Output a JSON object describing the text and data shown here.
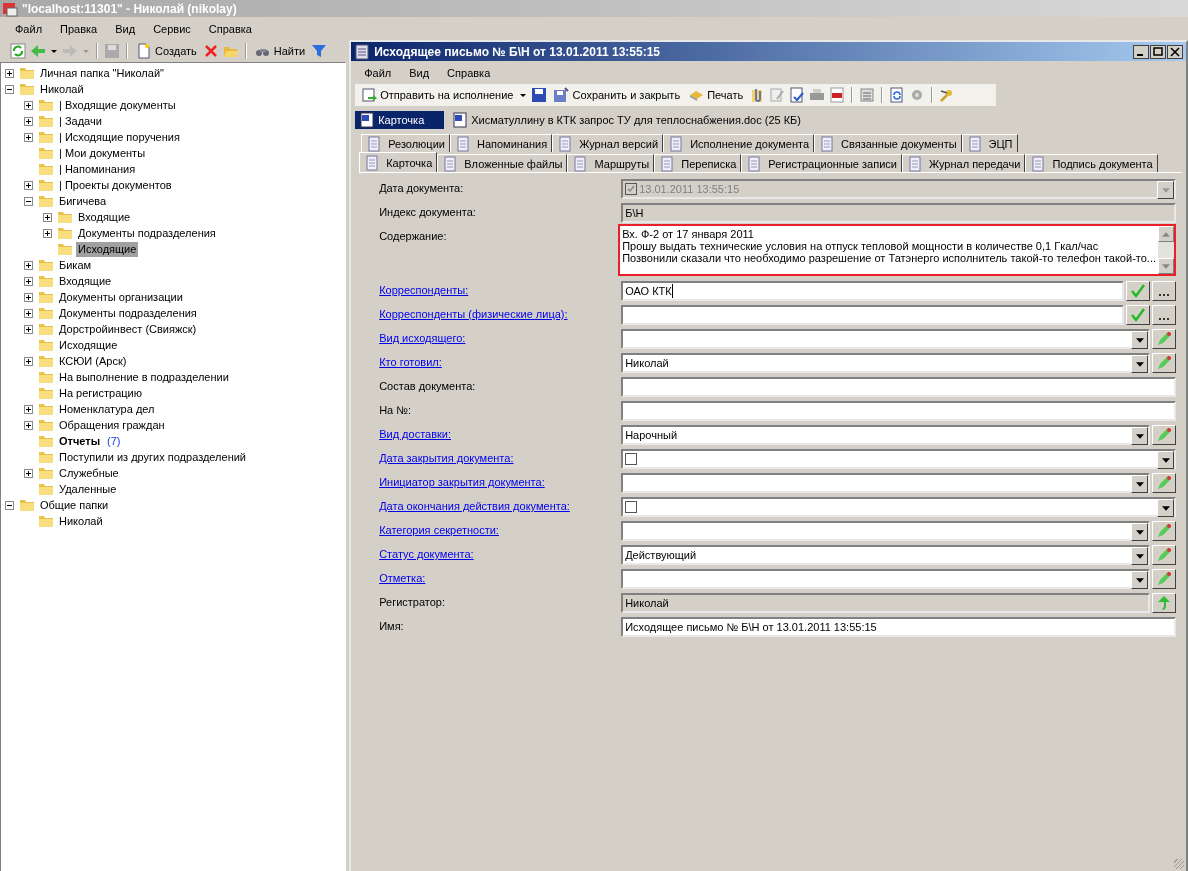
{
  "app": {
    "title": "\"localhost:11301\" - Николай (nikolay)",
    "menu": [
      "Файл",
      "Правка",
      "Вид",
      "Сервис",
      "Справка"
    ],
    "toolbar": [
      "Создать",
      "Найти"
    ]
  },
  "tree": [
    {
      "label": "Личная папка \"Николай\"",
      "expanded": false
    },
    {
      "label": "Николай",
      "expanded": true,
      "children": [
        {
          "label": "| Входящие документы",
          "expanded": false
        },
        {
          "label": "| Задачи",
          "expanded": false
        },
        {
          "label": "| Исходящие поручения",
          "expanded": false
        },
        {
          "label": "| Мои документы"
        },
        {
          "label": "| Напоминания"
        },
        {
          "label": "| Проекты документов",
          "expanded": false
        },
        {
          "label": "Бигичева",
          "expanded": true,
          "children": [
            {
              "label": "Входящие",
              "expanded": false
            },
            {
              "label": "Документы подразделения",
              "expanded": false
            },
            {
              "label": "Исходящие",
              "selected": true
            }
          ]
        },
        {
          "label": "Бикам",
          "expanded": false
        },
        {
          "label": "Входящие",
          "expanded": false
        },
        {
          "label": "Документы организации",
          "expanded": false
        },
        {
          "label": "Документы подразделения",
          "expanded": false
        },
        {
          "label": "Дорстройинвест (Свияжск)",
          "expanded": false
        },
        {
          "label": "Исходящие"
        },
        {
          "label": "КСЮИ (Арск)",
          "expanded": false
        },
        {
          "label": "На выполнение в подразделении"
        },
        {
          "label": "На регистрацию"
        },
        {
          "label": "Номенклатура дел",
          "expanded": false
        },
        {
          "label": "Обращения граждан",
          "expanded": false
        },
        {
          "label": "Отчеты",
          "bold": true,
          "count": "(7)"
        },
        {
          "label": "Поступили из других подразделений"
        },
        {
          "label": "Служебные",
          "expanded": false
        },
        {
          "label": "Удаленные"
        }
      ]
    },
    {
      "label": "Общие папки",
      "expanded": true,
      "children": [
        {
          "label": "Николай"
        }
      ]
    }
  ],
  "document": {
    "title": "Исходящее письмо № Б\\Н от 13.01.2011 13:55:15",
    "menu": [
      "Файл",
      "Вид",
      "Справка"
    ],
    "toolbar": [
      "Отправить на исполнение",
      "Сохранить и закрыть",
      "Печать"
    ],
    "attachments": [
      {
        "label": "Карточка",
        "selected": true
      },
      {
        "label": "Хисматуллину в КТК запрос ТУ для теплоснабжения.doc (25 КБ)",
        "selected": false
      }
    ],
    "tabs_back": [
      {
        "label": "Резолюции",
        "selected": false
      },
      {
        "label": "Напоминания",
        "selected": false
      },
      {
        "label": "Журнал версий",
        "selected": false
      },
      {
        "label": "Исполнение документа",
        "selected": false
      },
      {
        "label": "Связанные документы",
        "selected": false
      },
      {
        "label": "ЭЦП",
        "selected": false
      }
    ],
    "tabs_front": [
      {
        "label": "Карточка",
        "selected": true
      },
      {
        "label": "Вложенные файлы",
        "selected": false
      },
      {
        "label": "Маршруты",
        "selected": false
      },
      {
        "label": "Переписка",
        "selected": false
      },
      {
        "label": "Регистрационные записи",
        "selected": false
      },
      {
        "label": "Журнал передачи",
        "selected": false
      },
      {
        "label": "Подпись документа",
        "selected": false
      }
    ],
    "fields": [
      {
        "label": "Дата документа:",
        "link": false,
        "kind": "date",
        "checked": true,
        "disabled": true,
        "value": "13.01.2011 13:55:15"
      },
      {
        "label": "Индекс документа:",
        "link": false,
        "kind": "text",
        "disabled": true,
        "value": "Б\\Н"
      },
      {
        "label": "Содержание:",
        "link": false,
        "kind": "memo",
        "highlighted": true,
        "lines": [
          "Вх. Ф-2 от 17 января 2011",
          "Прошу выдать технические условия на отпуск тепловой мощности в количестве 0,1 Гкал/час",
          "Позвонили сказали что необходимо разрешение от Татэнерго исполнитель такой-то телефон такой-то..."
        ]
      },
      {
        "label": "Корреспонденты:",
        "link": true,
        "kind": "lookup",
        "value": "ОАО КТК",
        "focused": true
      },
      {
        "label": "Корреспонденты (физические лица):",
        "link": true,
        "kind": "lookup"
      },
      {
        "label": "Вид исходящего:",
        "link": true,
        "kind": "combo_edit"
      },
      {
        "label": "Кто готовил:",
        "link": true,
        "kind": "combo_edit",
        "value": "Николай"
      },
      {
        "label": "Состав документа:",
        "link": false,
        "kind": "text",
        "disabled": false
      },
      {
        "label": "На №:",
        "link": false,
        "kind": "text",
        "disabled": false
      },
      {
        "label": "Вид доставки:",
        "link": true,
        "kind": "combo_edit",
        "value": "Нарочный"
      },
      {
        "label": "Дата закрытия документа:",
        "link": true,
        "kind": "date",
        "checked": false,
        "disabled": false
      },
      {
        "label": "Инициатор закрытия документа:",
        "link": true,
        "kind": "combo_edit"
      },
      {
        "label": "Дата окончания действия документа:",
        "link": true,
        "kind": "date",
        "checked": false,
        "disabled": false
      },
      {
        "label": "Категория секретности:",
        "link": true,
        "kind": "combo_edit"
      },
      {
        "label": "Статус документа:",
        "link": true,
        "kind": "combo_edit",
        "value": "Действующий"
      },
      {
        "label": "Отметка:",
        "link": true,
        "kind": "combo_edit"
      },
      {
        "label": "Регистратор:",
        "link": false,
        "kind": "readonly_action",
        "value": "Николай"
      },
      {
        "label": "Имя:",
        "link": false,
        "kind": "text",
        "disabled": false,
        "value": "Исходящее письмо № Б\\Н от 13.01.2011 13:55:15"
      }
    ]
  }
}
